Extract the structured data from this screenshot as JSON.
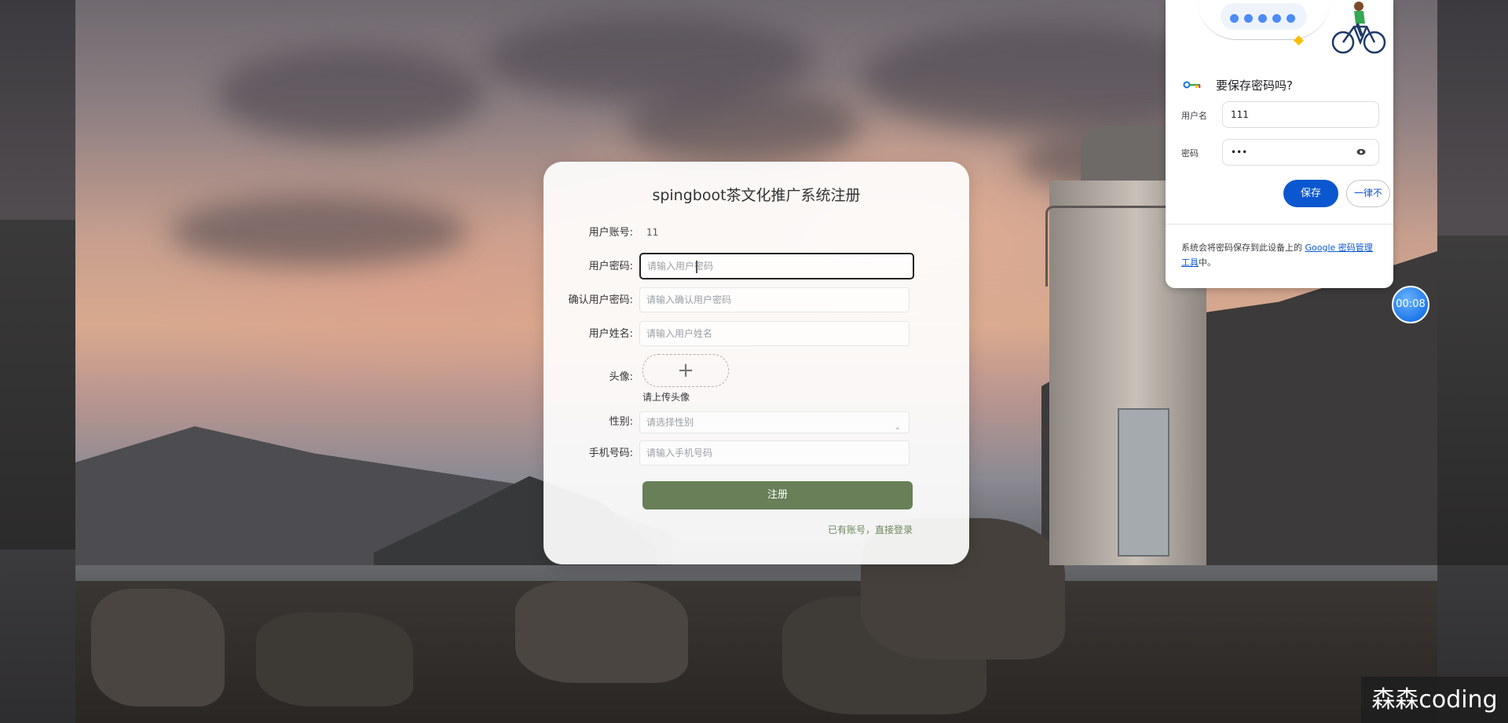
{
  "register_form": {
    "title": "spingboot茶文化推广系统注册",
    "account_label": "用户账号:",
    "account_value": "11",
    "password_label": "用户密码:",
    "password_placeholder": "请输入用户密码",
    "confirm_label": "确认用户密码:",
    "confirm_placeholder": "请输入确认用户密码",
    "name_label": "用户姓名:",
    "name_placeholder": "请输入用户姓名",
    "avatar_label": "头像:",
    "avatar_upload_symbol": "+",
    "avatar_hint": "请上传头像",
    "gender_label": "性别:",
    "gender_placeholder": "请选择性别",
    "phone_label": "手机号码:",
    "phone_placeholder": "请输入手机号码",
    "submit_label": "注册",
    "login_link": "已有账号，直接登录",
    "accent_color": "#687f57"
  },
  "save_password_popup": {
    "title": "要保存密码吗?",
    "username_label": "用户名",
    "username_value": "111",
    "password_label": "密码",
    "password_value": "•••",
    "save_label": "保存",
    "never_label": "一律不",
    "footer_text": "系统会将密码保存到此设备上的",
    "footer_link": "Google 密码管理工具",
    "footer_suffix": "中。",
    "accent_color": "#0b57d0"
  },
  "timer": {
    "value": "00:08"
  },
  "watermark": {
    "text": "森森coding"
  }
}
